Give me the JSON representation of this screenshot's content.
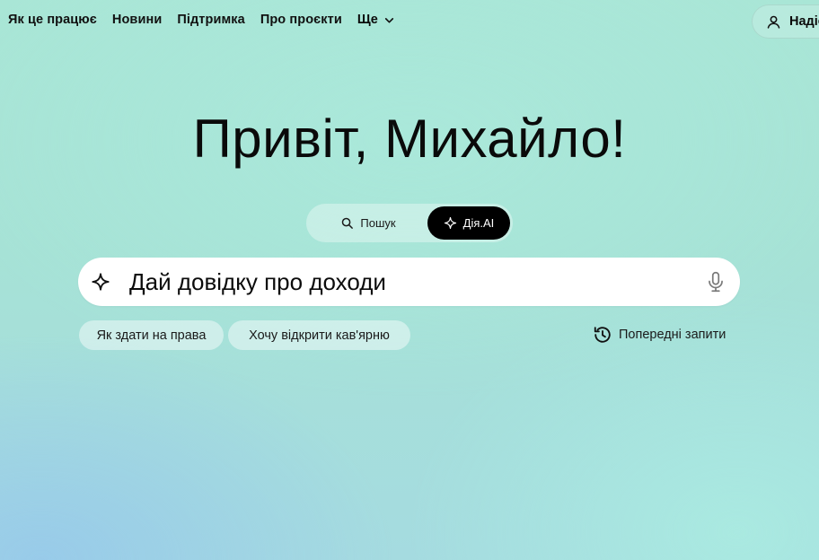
{
  "nav": {
    "items": [
      {
        "label": "Як це працює"
      },
      {
        "label": "Новини"
      },
      {
        "label": "Підтримка"
      },
      {
        "label": "Про проєкти"
      }
    ],
    "more_label": "Ще",
    "login_label": "Надіслати"
  },
  "hero": {
    "greeting": "Привіт, Михайло!"
  },
  "modes": {
    "search_label": "Пошук",
    "ai_label": "Дія.AI",
    "active": "Дія.AI"
  },
  "search": {
    "value": "Дай довідку про доходи"
  },
  "suggestions": [
    {
      "label": "Як здати на права"
    },
    {
      "label": "Хочу відкрити кав'ярню"
    }
  ],
  "history_label": "Попередні запити",
  "icons": {
    "more": "chevron-down-icon",
    "login": "user-icon",
    "search": "search-icon",
    "ai": "sparkle-icon",
    "mic": "microphone-icon",
    "history": "history-icon"
  },
  "colors": {
    "active_tab_bg": "#000000",
    "active_tab_text": "#ffffff"
  }
}
